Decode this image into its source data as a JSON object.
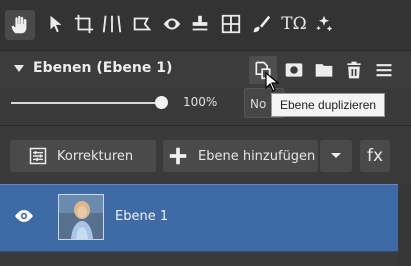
{
  "toolbar": {
    "tools": [
      {
        "icon": "hand-icon",
        "active": true
      },
      {
        "icon": "arrow-cursor-icon"
      },
      {
        "icon": "crop-icon"
      },
      {
        "icon": "straighten-icon"
      },
      {
        "icon": "selection-icon"
      },
      {
        "icon": "eye-redeye-icon"
      },
      {
        "icon": "stamp-icon"
      },
      {
        "icon": "transform-icon"
      },
      {
        "icon": "brush-icon"
      },
      {
        "icon": "text-icon",
        "label": "TΩ"
      },
      {
        "icon": "effects-icon"
      }
    ]
  },
  "panel": {
    "title": "Ebenen (Ebene 1)",
    "actions": [
      "duplicate-layer-icon",
      "mask-icon",
      "folder-icon",
      "trash-icon",
      "menu-icon"
    ]
  },
  "opacity": {
    "value": 1.0,
    "label": "100%"
  },
  "tooltip": {
    "partial_label": "No",
    "text": "Ebene duplizieren"
  },
  "buttons": {
    "korrekturen": "Korrekturen",
    "add_layer": "Ebene hinzufügen",
    "fx": "fx"
  },
  "layers": [
    {
      "name": "Ebene 1",
      "visible": true,
      "selected": true
    }
  ],
  "colors": {
    "selected_row": "#3e6aa5",
    "panel_bg": "#3a3a3a"
  }
}
